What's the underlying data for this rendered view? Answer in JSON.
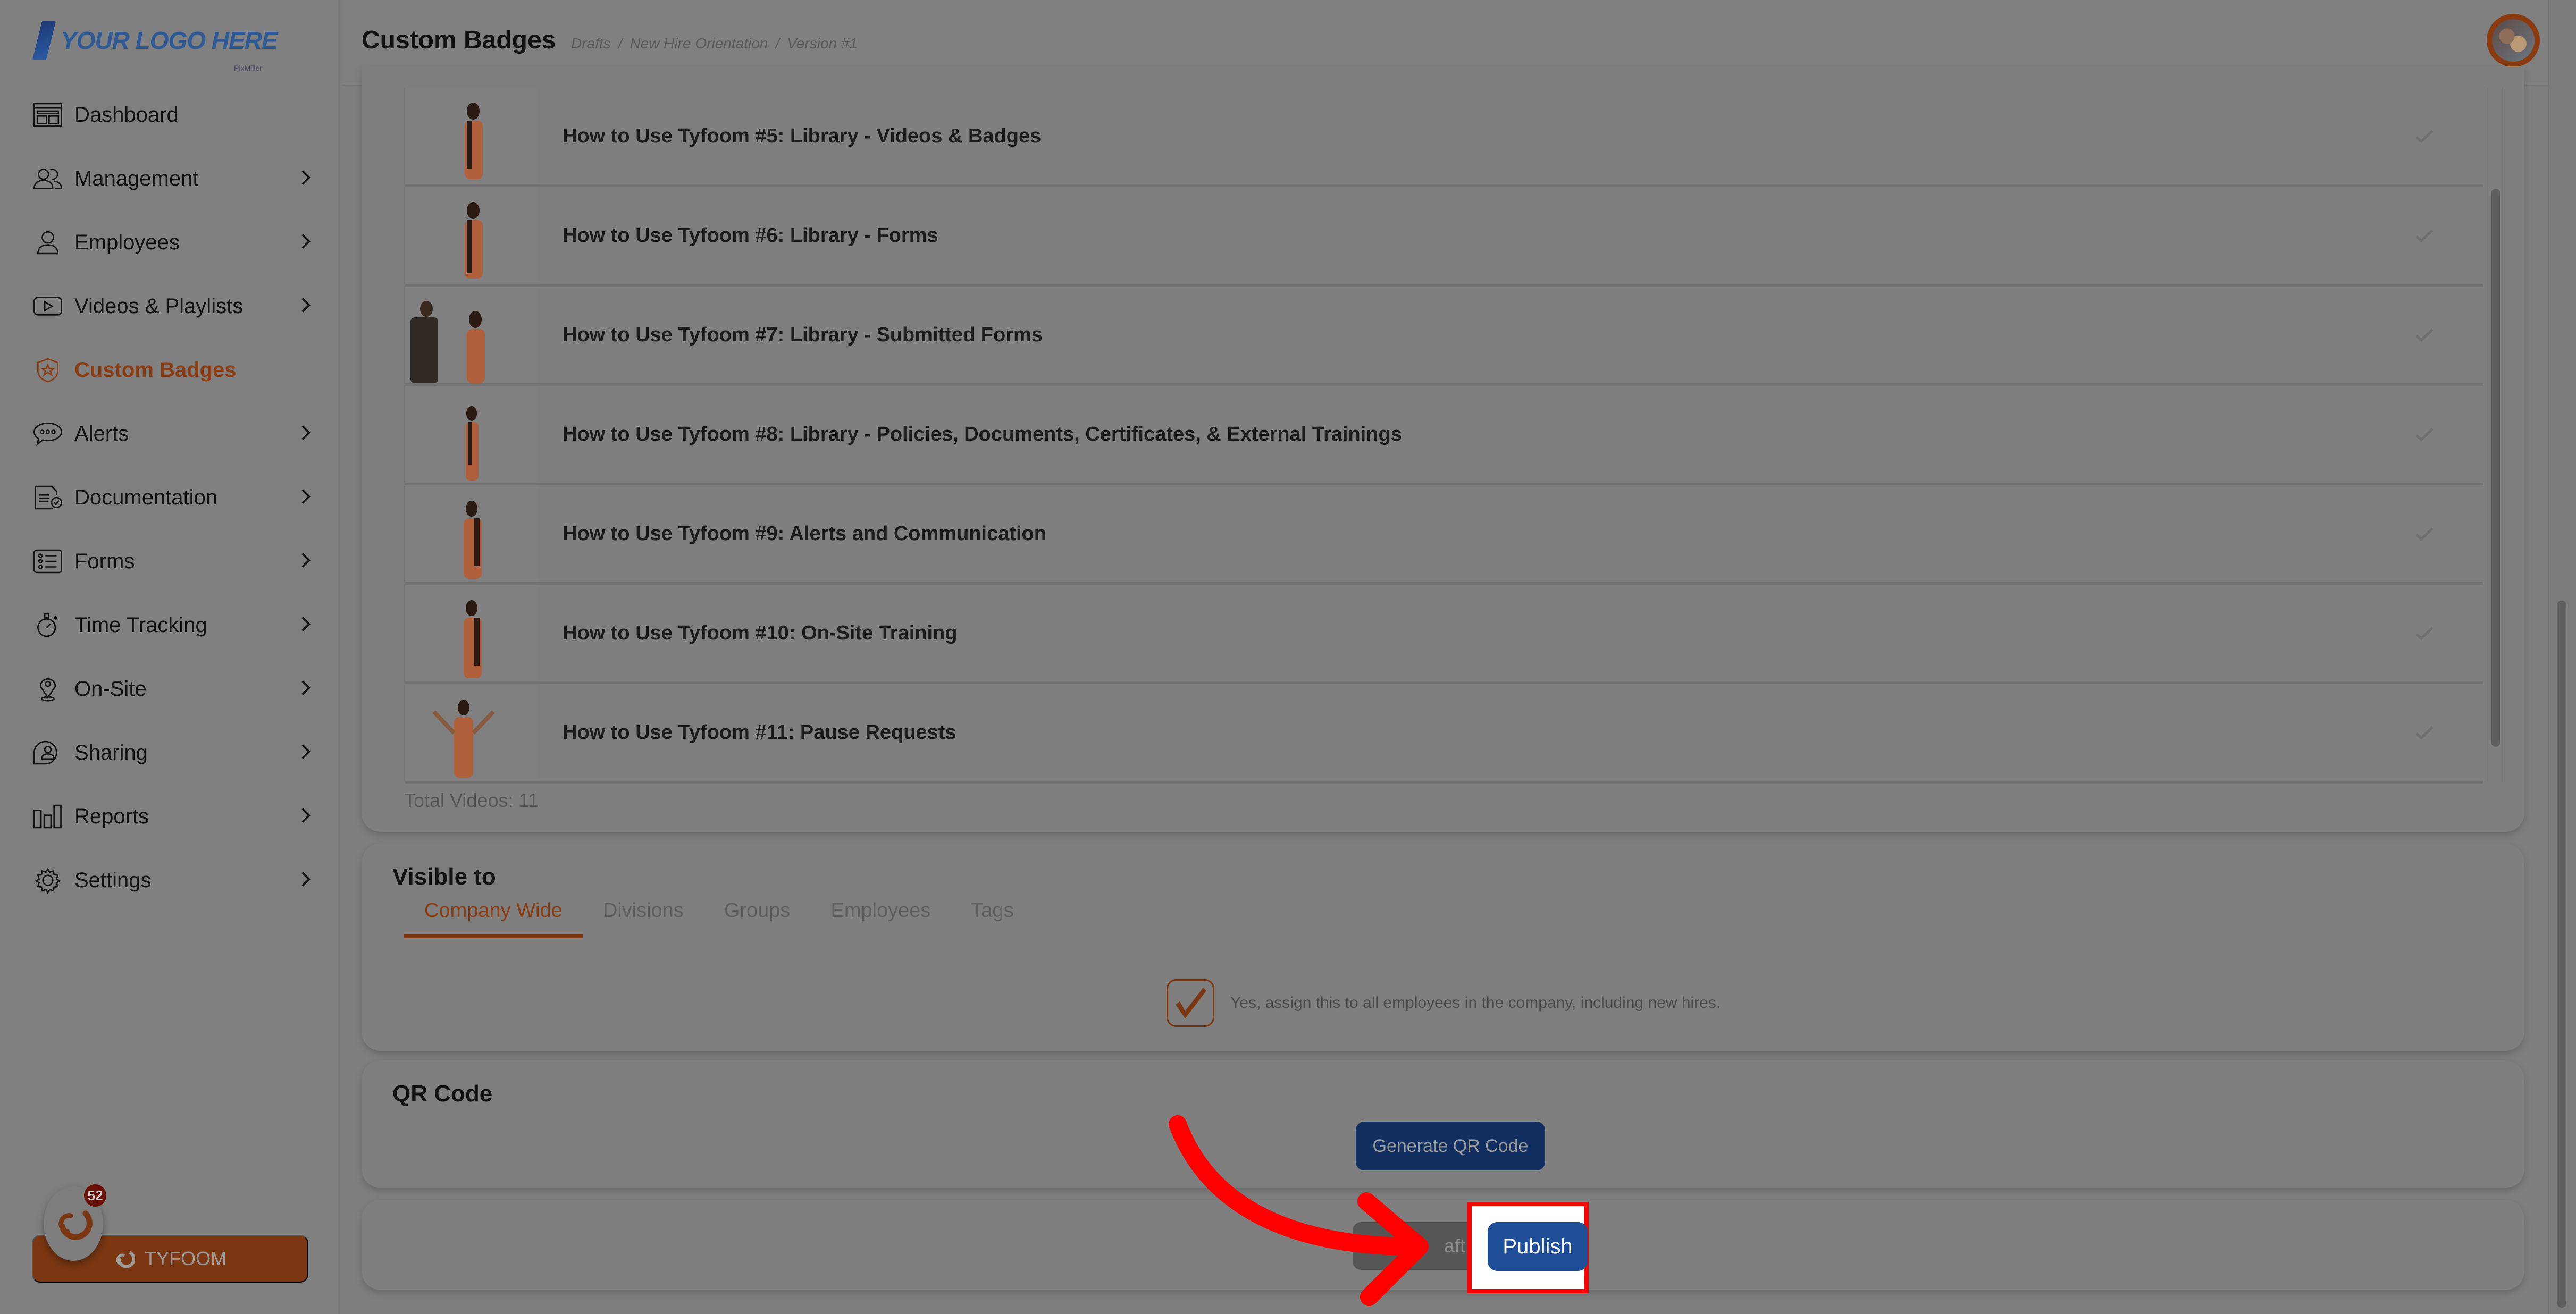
{
  "app": {
    "logo_text": "YOUR LOGO HERE",
    "logo_sub": "PixMiller"
  },
  "header": {
    "title": "Custom Badges",
    "breadcrumb": [
      "Drafts",
      "/",
      "New Hire Orientation",
      "/",
      "Version #1"
    ],
    "avatar_alt": "user-avatar"
  },
  "sidebar": {
    "items": [
      {
        "label": "Dashboard",
        "icon": "dashboard-icon",
        "has_chevron": false
      },
      {
        "label": "Management",
        "icon": "people-icon",
        "has_chevron": true
      },
      {
        "label": "Employees",
        "icon": "user-icon",
        "has_chevron": true
      },
      {
        "label": "Videos & Playlists",
        "icon": "video-icon",
        "has_chevron": true
      },
      {
        "label": "Custom Badges",
        "icon": "badge-icon",
        "has_chevron": false,
        "active": true
      },
      {
        "label": "Alerts",
        "icon": "chat-icon",
        "has_chevron": true
      },
      {
        "label": "Documentation",
        "icon": "document-icon",
        "has_chevron": true
      },
      {
        "label": "Forms",
        "icon": "list-icon",
        "has_chevron": true
      },
      {
        "label": "Time Tracking",
        "icon": "stopwatch-icon",
        "has_chevron": true
      },
      {
        "label": "On-Site",
        "icon": "location-pin-icon",
        "has_chevron": true
      },
      {
        "label": "Sharing",
        "icon": "share-user-icon",
        "has_chevron": true
      },
      {
        "label": "Reports",
        "icon": "bar-chart-icon",
        "has_chevron": true
      },
      {
        "label": "Settings",
        "icon": "gear-icon",
        "has_chevron": true
      }
    ],
    "tyfoom_button": "TYFOOM",
    "notification_count": "52"
  },
  "videos": {
    "items": [
      {
        "title": "How to Use Tyfoom #5: Library - Videos & Badges",
        "completed": true
      },
      {
        "title": "How to Use Tyfoom #6: Library - Forms",
        "completed": true
      },
      {
        "title": "How to Use Tyfoom #7: Library - Submitted Forms",
        "completed": true
      },
      {
        "title": "How to Use Tyfoom #8: Library - Policies, Documents, Certificates, & External Trainings",
        "completed": true
      },
      {
        "title": "How to Use Tyfoom #9: Alerts and Communication",
        "completed": true
      },
      {
        "title": "How to Use Tyfoom #10: On-Site Training",
        "completed": true
      },
      {
        "title": "How to Use Tyfoom #11: Pause Requests",
        "completed": true
      }
    ],
    "total_label": "Total Videos: 11"
  },
  "visible_to": {
    "title": "Visible to",
    "tabs": [
      "Company Wide",
      "Divisions",
      "Groups",
      "Employees",
      "Tags"
    ],
    "active_tab": "Company Wide",
    "assign_checked": true,
    "assign_label": "Yes, assign this to all employees in the company, including new hires."
  },
  "qr": {
    "title": "QR Code",
    "button": "Generate QR Code"
  },
  "actions": {
    "draft_button_visible_text": "aft",
    "publish_button": "Publish"
  },
  "colors": {
    "accent": "#8a3c10",
    "primary_button": "#1d4e97",
    "annotation": "#ff0000"
  }
}
